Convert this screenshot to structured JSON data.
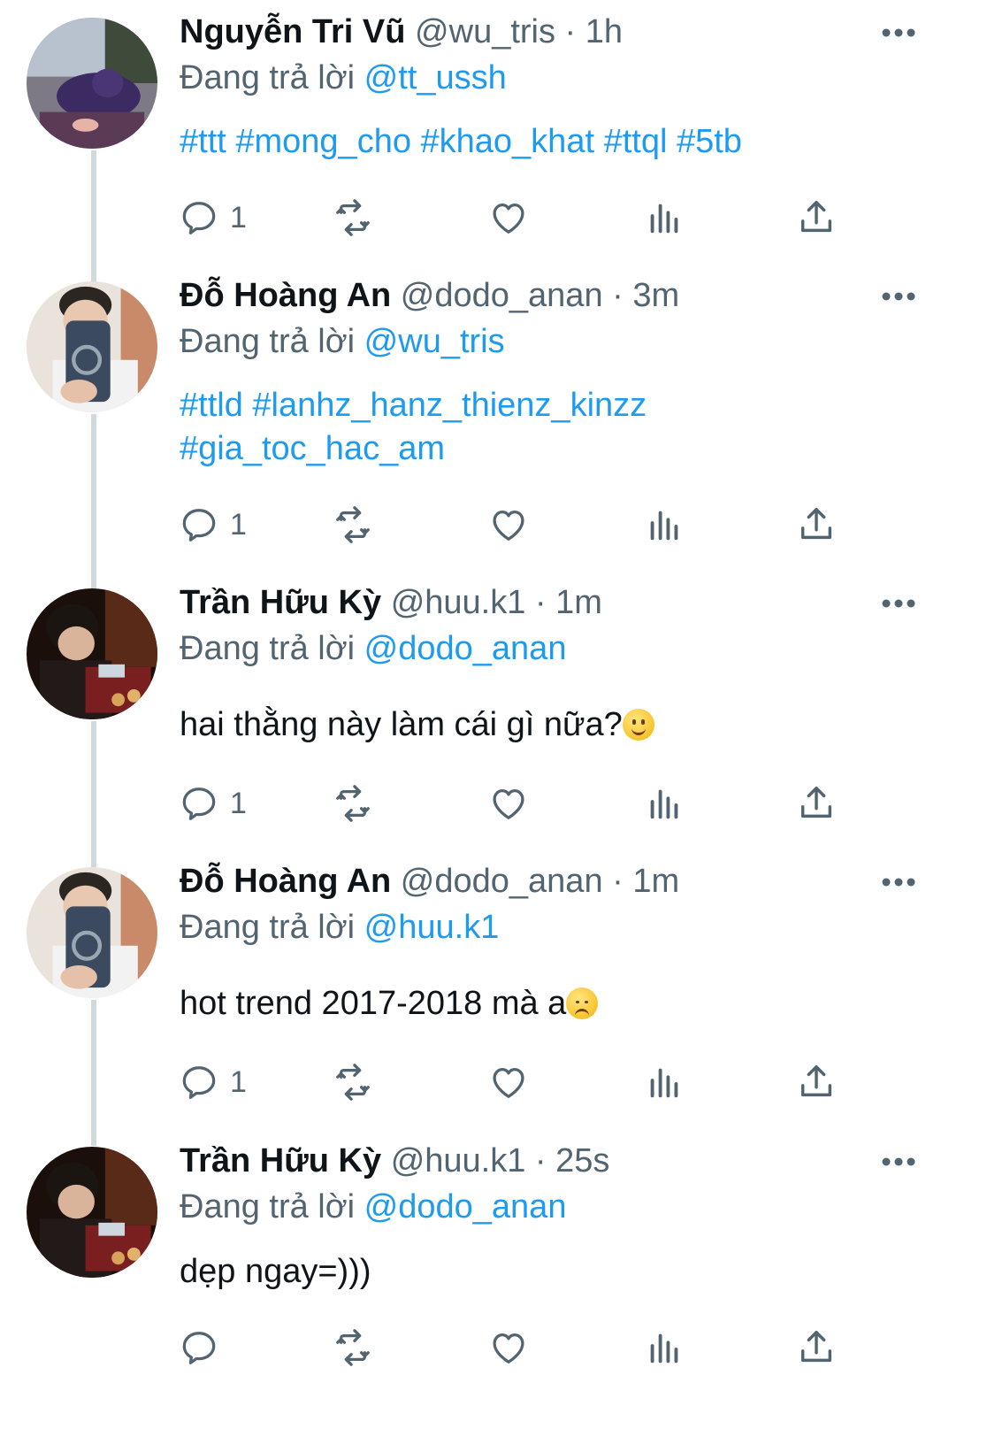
{
  "colors": {
    "accent": "#1d9bf0",
    "text": "#0f1419",
    "muted": "#536471",
    "thread_line": "#cfd9de"
  },
  "tweets": [
    {
      "name": "Nguyễn Tri Vũ",
      "meta": "@wu_tris · 1h",
      "reply_prefix": "Đang trả lời",
      "reply_to": "@tt_ussh",
      "content_lines": [
        "#ttt #mong_cho #khao_khat #ttql #5tb"
      ],
      "content_is_tags": true,
      "reply_count": "1"
    },
    {
      "name": "Đỗ Hoàng An",
      "meta": "@dodo_anan · 3m",
      "reply_prefix": "Đang trả lời",
      "reply_to": "@wu_tris",
      "content_lines": [
        "#ttld #lanhz_hanz_thienz_kinzz",
        "#gia_toc_hac_am"
      ],
      "content_is_tags": true,
      "reply_count": "1"
    },
    {
      "name": "Trần Hữu Kỳ",
      "meta": "@huu.k1 · 1m",
      "reply_prefix": "Đang trả lời",
      "reply_to": "@dodo_anan",
      "content_lines": [
        "hai thằng này làm cái gì nữa?"
      ],
      "content_emoji": "slightly-smiling-face",
      "content_is_tags": false,
      "reply_count": "1"
    },
    {
      "name": "Đỗ Hoàng An",
      "meta": "@dodo_anan · 1m",
      "reply_prefix": "Đang trả lời",
      "reply_to": "@huu.k1",
      "content_lines": [
        "hot trend 2017-2018 mà a"
      ],
      "content_emoji": "pensive-face",
      "content_is_tags": false,
      "reply_count": "1"
    },
    {
      "name": "Trần Hữu Kỳ",
      "meta": "@huu.k1 · 25s",
      "reply_prefix": "Đang trả lời",
      "reply_to": "@dodo_anan",
      "content_lines": [
        "dẹp ngay=)))"
      ],
      "content_is_tags": false,
      "reply_count": ""
    }
  ]
}
